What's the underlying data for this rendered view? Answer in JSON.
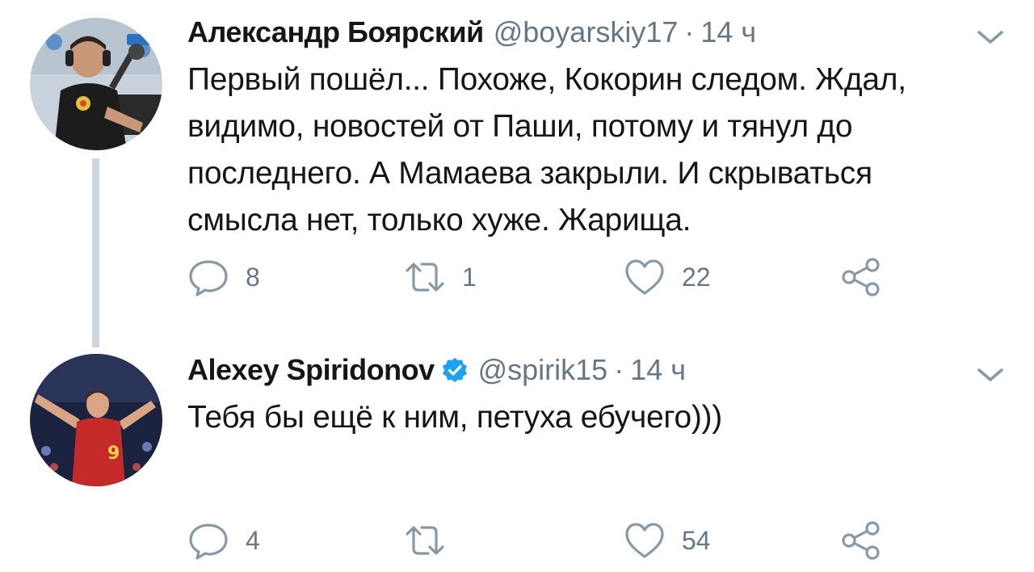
{
  "tweets": [
    {
      "name": "Александр Боярский",
      "handle": "@boyarskiy17",
      "separator": "·",
      "time": "14 ч",
      "verified": false,
      "text": "Первый пошёл... Похоже, Кокорин следом. Ждал, видимо, новостей от Паши, потому и тянул до последнего. А Мамаева закрыли. И скрываться смысла нет, только хуже. Жарища.",
      "replies": "8",
      "retweets": "1",
      "likes": "22"
    },
    {
      "name": "Alexey Spiridonov",
      "handle": "@spirik15",
      "separator": "·",
      "time": "14 ч",
      "verified": true,
      "text": "Тебя бы ещё к ним, петуха ебучего)))",
      "replies": "4",
      "retweets": "",
      "likes": "54"
    }
  ],
  "colors": {
    "text": "#14171a",
    "secondary": "#657786",
    "verified": "#1da1f2",
    "thread_line": "#cdd6dd"
  },
  "icons": [
    "reply-icon",
    "retweet-icon",
    "like-icon",
    "share-icon",
    "chevron-down-icon",
    "verified-badge-icon"
  ]
}
